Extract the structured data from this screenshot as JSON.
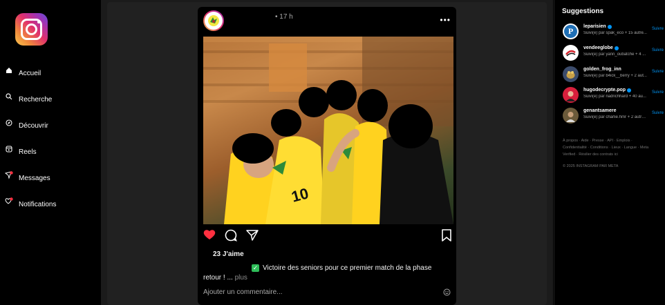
{
  "nav": {
    "items": [
      {
        "label": "Accueil",
        "icon": "home-icon"
      },
      {
        "label": "Recherche",
        "icon": "search-icon"
      },
      {
        "label": "Découvrir",
        "icon": "explore-icon"
      },
      {
        "label": "Reels",
        "icon": "reels-icon"
      },
      {
        "label": "Messages",
        "icon": "messages-icon"
      },
      {
        "label": "Notifications",
        "icon": "heart-icon"
      }
    ]
  },
  "post": {
    "time": "• 17 h",
    "likes": "23 J'aime",
    "caption_line1": "Victoire des seniors pour ce premier match de la phase",
    "caption_line2": "retour ! ...",
    "more_label": "plus",
    "comment_placeholder": "Ajouter un commentaire..."
  },
  "suggestions": {
    "title": "Suggestions",
    "items": [
      {
        "name": "leparisien",
        "verified": true,
        "sub": "Suivi(e) par spak_eco + 15 autre...",
        "follow": "Suivre"
      },
      {
        "name": "vendeeglobe",
        "verified": true,
        "sub": "Suivi(e) par yann_oubatche + 4 ...",
        "follow": "Suivre"
      },
      {
        "name": "golden_frog_inn",
        "verified": false,
        "sub": "Suivi(e) par b4ick__berry + 2 aut...",
        "follow": "Suivre"
      },
      {
        "name": "hugodecrypte.pop",
        "verified": true,
        "sub": "Suivi(e) par nadrichhard + 40 au...",
        "follow": "Suivre"
      },
      {
        "name": "genantsamere",
        "verified": false,
        "sub": "Suivi(e) par charlie.hmr + 2 autre...",
        "follow": "Suivre"
      }
    ],
    "footer": "À propos · Aide · Presse · API · Emplois · Confidentialité · Conditions · Lieux · Langue · Meta Verified · Résilier des contrats ici",
    "copyright": "© 2025 INSTAGRAM PAR META"
  },
  "colors": {
    "accent": "#0095f6",
    "like": "#ff3040",
    "background": "#000000",
    "feed": "#212121"
  }
}
